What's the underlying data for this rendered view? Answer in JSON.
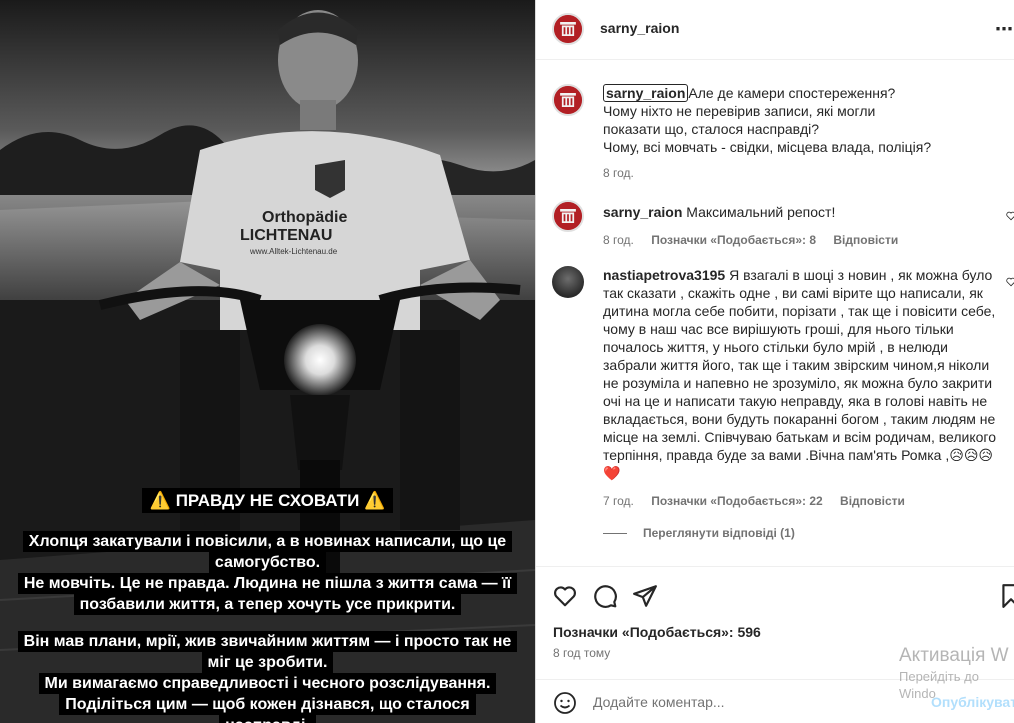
{
  "story": {
    "title": "⚠️ ПРАВДУ НЕ СХОВАТИ ⚠️",
    "shirt_text": [
      "Orthopädie",
      "LICHTENAU",
      "www.Alltek-Lichtenau.de"
    ],
    "lines_group1": [
      "Хлопця закатували і повісили, а в новинах написали, що це",
      "самогубство.",
      "Не мовчіть. Це не правда. Людина не пішла з життя сама — її",
      "позбавили життя, а тепер хочуть усе прикрити."
    ],
    "lines_group2": [
      "Він мав плани, мрії, жив звичайним життям — і просто так не",
      "міг це зробити.",
      "Ми вимагаємо справедливості і чесного розслідування.",
      "Поділіться цим — щоб кожен дізнався, що сталося",
      "насправді."
    ]
  },
  "header": {
    "username": "sarny_raion",
    "more_icon": "⋯"
  },
  "caption": {
    "username": "sarny_raion",
    "text_line1": "Але де камери спостереження?",
    "text_rest": [
      "Чому ніхто не перевірив записи, які могли",
      "показати що, сталося насправді?",
      "Чому, всі мовчать - свідки, місцева влада, поліція?"
    ],
    "time": "8 год."
  },
  "comments": [
    {
      "username": "sarny_raion",
      "text": "Максимальний репост!",
      "time": "8 год.",
      "likes": "Позначки «Подобається»: 8",
      "reply": "Відповісти"
    },
    {
      "username": "nastiapetrova3195",
      "text": "Я взагалі в шоці з новин , як можна було так сказати , скажіть одне , ви самі вірите що написали, як дитина могла себе побити, порізати , так ще і повісити себе, чому в наш час все вирішують гроші, для нього тільки почалось життя, у нього стільки було мрій , в нелюди забрали життя його, так ще і таким звірским чином,я ніколи не розуміла и напевно не зрозуміло, як можна було закрити очі на це и написати такую неправду, яка в голові навіть не вкладається, вони будуть покаранні богом , таким людям не місце на землі. Співчуваю батькам и всім родичам, великого терпіння, правда буде за вами .Вічна пам'ять Ромка ,😥😥😥❤️",
      "time": "7 год.",
      "likes": "Позначки «Подобається»: 22",
      "reply": "Відповісти"
    }
  ],
  "view_replies": "Переглянути відповіді (1)",
  "post": {
    "likes": "Позначки «Подобається»: 596",
    "time_ago": "8 год тому"
  },
  "composer": {
    "placeholder": "Додайте коментар...",
    "post_label": "Опублікувати"
  },
  "watermark": {
    "line1": "Активація W",
    "line2": "Перейдіть до",
    "line3": "Windo"
  },
  "icons": [
    "heart-icon",
    "comment-icon",
    "share-icon",
    "bookmark-icon",
    "smile-icon",
    "more-icon"
  ]
}
